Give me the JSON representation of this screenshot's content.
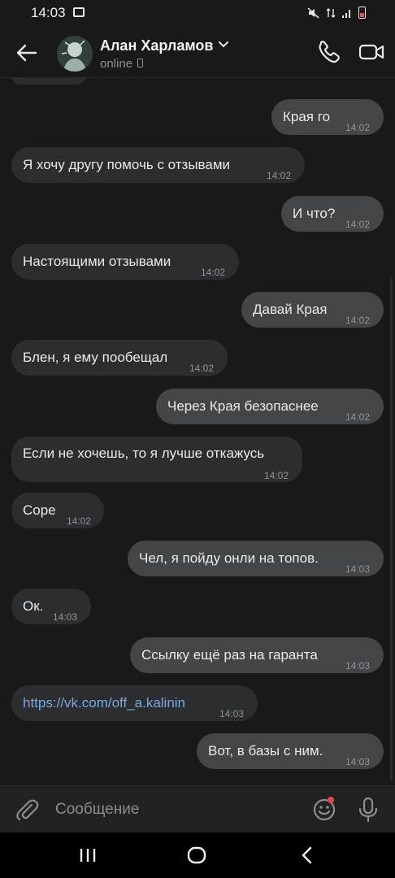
{
  "status_bar": {
    "time": "14:03"
  },
  "header": {
    "contact_name": "Алан Харламов",
    "contact_status": "online"
  },
  "messages": [
    {
      "dir": "out",
      "text": "Края го",
      "time": "14:02"
    },
    {
      "dir": "in",
      "text": "Я хочу другу помочь с отзывами",
      "time": "14:02"
    },
    {
      "dir": "out",
      "text": "И что?",
      "time": "14:02"
    },
    {
      "dir": "in",
      "text": "Настоящими отзывами",
      "time": "14:02"
    },
    {
      "dir": "out",
      "text": "Давай Края",
      "time": "14:02"
    },
    {
      "dir": "in",
      "text": "Блен, я ему пообещал",
      "time": "14:02"
    },
    {
      "dir": "out",
      "text": "Через Края безопаснее",
      "time": "14:02"
    },
    {
      "dir": "in",
      "text": "Если не хочешь, то я лучше откажусь",
      "time": "14:02"
    },
    {
      "dir": "in",
      "text": "Соре",
      "time": "14:02"
    },
    {
      "dir": "out",
      "text": "Чел, я пойду онли на топов.",
      "time": "14:03"
    },
    {
      "dir": "in",
      "text": "Ок.",
      "time": "14:03"
    },
    {
      "dir": "out",
      "text": "Ссылку ещё раз на гаранта",
      "time": "14:03"
    },
    {
      "dir": "in",
      "text": "https://vk.com/off_a.kalinin",
      "time": "14:03",
      "is_link": true
    },
    {
      "dir": "out",
      "text": "Вот, в базы с ним.",
      "time": "14:03"
    }
  ],
  "composer": {
    "placeholder": "Сообщение"
  },
  "colors": {
    "background": "#19191a",
    "incoming_bubble": "#2c2d2e",
    "outgoing_bubble": "#444547",
    "link": "#71aaeb",
    "notification_dot": "#e64646"
  },
  "icons": {
    "back": "arrow-left-icon",
    "call": "phone-icon",
    "video": "video-camera-icon",
    "attach": "paperclip-icon",
    "emoji": "smiley-icon",
    "mic": "microphone-icon"
  }
}
